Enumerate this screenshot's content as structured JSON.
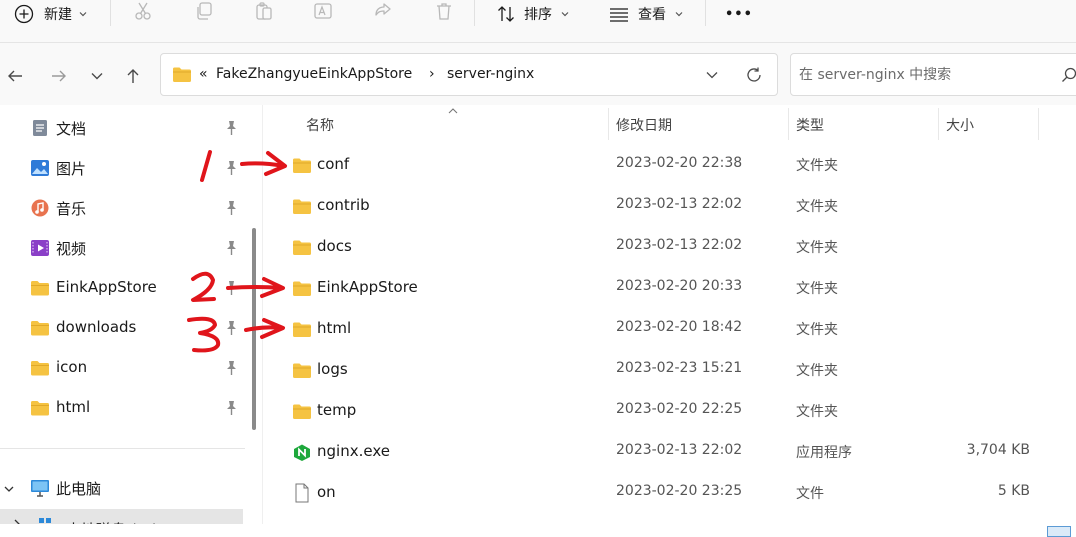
{
  "toolbar": {
    "new_label": "新建",
    "sort_label": "排序",
    "view_label": "查看",
    "more_label": "•••"
  },
  "address": {
    "overflow": "«",
    "crumbs": [
      "FakeZhangyueEinkAppStore",
      "server-nginx"
    ],
    "separator": "›"
  },
  "search": {
    "placeholder": "在 server-nginx 中搜索"
  },
  "sidebar": {
    "quick": [
      {
        "label": "文档",
        "icon": "document-icon"
      },
      {
        "label": "图片",
        "icon": "pictures-icon"
      },
      {
        "label": "音乐",
        "icon": "music-icon"
      },
      {
        "label": "视频",
        "icon": "video-icon"
      },
      {
        "label": "EinkAppStore",
        "icon": "folder-icon"
      },
      {
        "label": "downloads",
        "icon": "folder-icon"
      },
      {
        "label": "icon",
        "icon": "folder-icon"
      },
      {
        "label": "html",
        "icon": "folder-icon"
      }
    ],
    "this_pc": "此电脑",
    "local_disk": "本地磁盘 (C:)"
  },
  "columns": {
    "name": "名称",
    "modified": "修改日期",
    "type": "类型",
    "size": "大小"
  },
  "files": [
    {
      "name": "conf",
      "date": "2023-02-20 22:38",
      "type": "文件夹",
      "size": "",
      "icon": "folder-icon"
    },
    {
      "name": "contrib",
      "date": "2023-02-13 22:02",
      "type": "文件夹",
      "size": "",
      "icon": "folder-icon"
    },
    {
      "name": "docs",
      "date": "2023-02-13 22:02",
      "type": "文件夹",
      "size": "",
      "icon": "folder-icon"
    },
    {
      "name": "EinkAppStore",
      "date": "2023-02-20 20:33",
      "type": "文件夹",
      "size": "",
      "icon": "folder-icon"
    },
    {
      "name": "html",
      "date": "2023-02-20 18:42",
      "type": "文件夹",
      "size": "",
      "icon": "folder-icon"
    },
    {
      "name": "logs",
      "date": "2023-02-23 15:21",
      "type": "文件夹",
      "size": "",
      "icon": "folder-icon"
    },
    {
      "name": "temp",
      "date": "2023-02-20 22:25",
      "type": "文件夹",
      "size": "",
      "icon": "folder-icon"
    },
    {
      "name": "nginx.exe",
      "date": "2023-02-13 22:02",
      "type": "应用程序",
      "size": "3,704 KB",
      "icon": "nginx-app-icon"
    },
    {
      "name": "on",
      "date": "2023-02-20 23:25",
      "type": "文件",
      "size": "5 KB",
      "icon": "file-icon"
    }
  ],
  "annotations": [
    "1",
    "2",
    "3"
  ],
  "colors": {
    "folder": "#f5c342",
    "annotation": "#e0151b",
    "nginx": "#1ea83c"
  }
}
